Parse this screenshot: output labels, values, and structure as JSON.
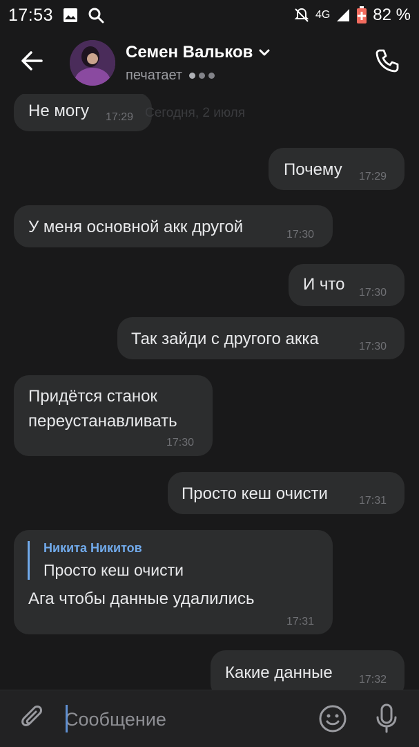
{
  "status_bar": {
    "time": "17:53",
    "network": "4G",
    "battery": "82 %"
  },
  "header": {
    "contact_name": "Семен Вальков",
    "status": "печатает"
  },
  "date_divider": "Сегодня, 2 июля",
  "messages": [
    {
      "dir": "in",
      "text": "Не могу",
      "time": "17:29"
    },
    {
      "dir": "out",
      "text": "Почему",
      "time": "17:29"
    },
    {
      "dir": "in",
      "text": "У меня основной акк другой",
      "time": "17:30"
    },
    {
      "dir": "out",
      "text": "И что",
      "time": "17:30"
    },
    {
      "dir": "out",
      "text": "Так зайди с другого акка",
      "time": "17:30"
    },
    {
      "dir": "in",
      "text_line1": "Придётся станок",
      "text_line2": "переустанавливать",
      "time": "17:30"
    },
    {
      "dir": "out",
      "text": "Просто кеш очисти",
      "time": "17:31"
    },
    {
      "dir": "in",
      "reply_author": "Никита Никитов",
      "reply_text": "Просто кеш очисти",
      "text": "Ага чтобы данные удалились",
      "time": "17:31"
    },
    {
      "dir": "out",
      "text": "Какие данные",
      "time": "17:32"
    }
  ],
  "composer": {
    "placeholder": "Сообщение"
  },
  "icons": {
    "back": "arrow-left-icon",
    "call": "phone-icon",
    "attach": "paperclip-icon",
    "emoji": "smiley-icon",
    "mic": "microphone-icon"
  },
  "colors": {
    "background": "#19191a",
    "bubble": "#2c2d2e",
    "accent": "#71aaeb"
  }
}
